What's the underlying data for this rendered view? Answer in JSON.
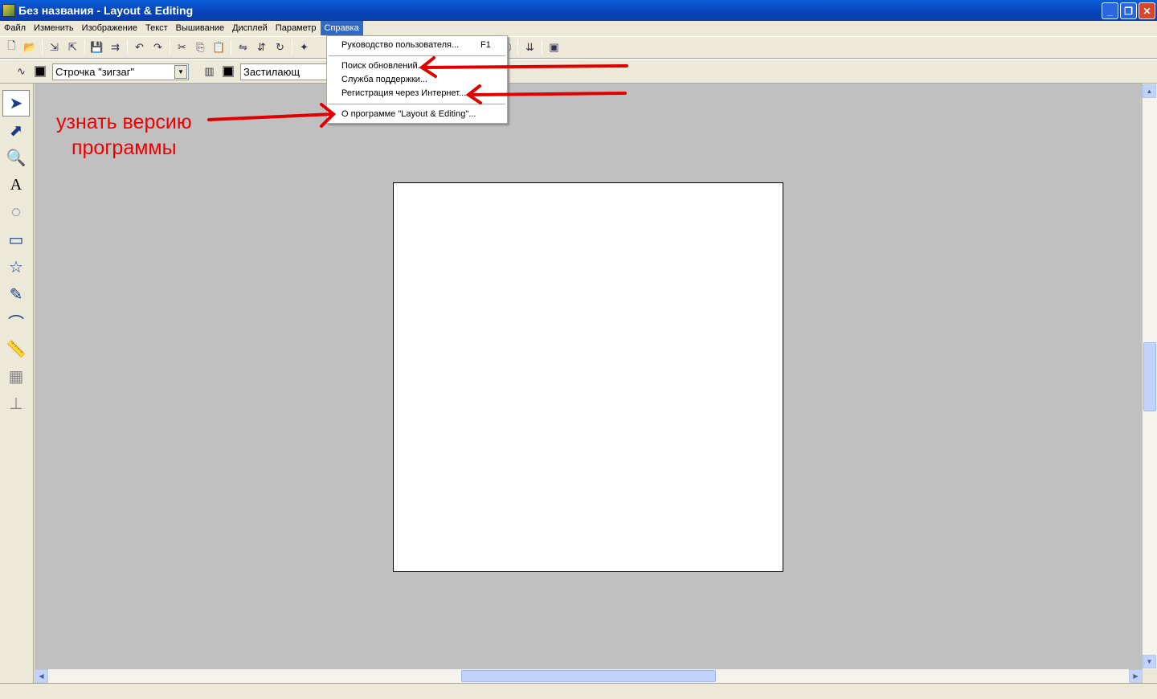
{
  "window": {
    "title": "Без названия - Layout & Editing"
  },
  "menu": [
    "Файл",
    "Изменить",
    "Изображение",
    "Текст",
    "Вышивание",
    "Дисплей",
    "Параметр",
    "Справка"
  ],
  "toolbar2": {
    "stitch_type": "Строчка \"зигзаг\"",
    "fill_type": "Застилающ"
  },
  "help_menu": {
    "items": [
      {
        "label": "Руководство пользователя...",
        "shortcut": "F1"
      },
      {
        "label": "Поиск обновлений..."
      },
      {
        "label": "Служба поддержки..."
      },
      {
        "label": "Регистрация через Интернет..."
      },
      {
        "label": "О программе \"Layout & Editing\"..."
      }
    ]
  },
  "annotation": {
    "line1": "узнать версию",
    "line2": "программы",
    "color": "#e00000"
  }
}
